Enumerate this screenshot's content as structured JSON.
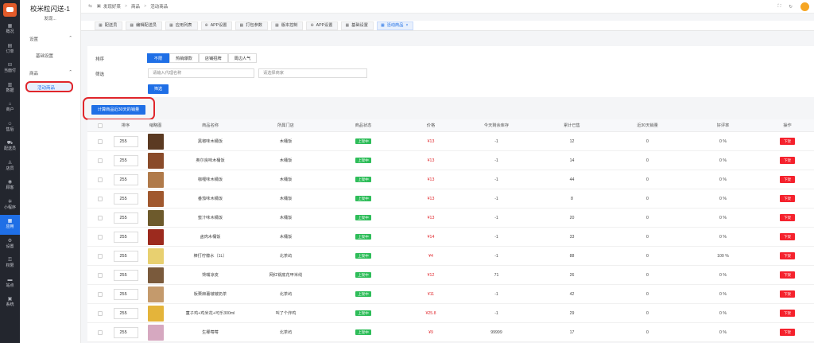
{
  "nav": {
    "items": [
      {
        "icon": "▦",
        "label": "概况"
      },
      {
        "icon": "▤",
        "label": "订单"
      },
      {
        "icon": "⊟",
        "label": "当面付"
      },
      {
        "icon": "▥",
        "label": "数据"
      },
      {
        "icon": "⌂",
        "label": "商户"
      },
      {
        "icon": "☺",
        "label": "售后"
      },
      {
        "icon": "⛟",
        "label": "配送员"
      },
      {
        "icon": "♙",
        "label": "店员"
      },
      {
        "icon": "◉",
        "label": "顾客"
      },
      {
        "icon": "✲",
        "label": "小程序"
      },
      {
        "icon": "▦",
        "label": "应用"
      },
      {
        "icon": "⚙",
        "label": "设置"
      },
      {
        "icon": "⚿",
        "label": "权限"
      },
      {
        "icon": "▬",
        "label": "站点"
      },
      {
        "icon": "▣",
        "label": "系统"
      }
    ],
    "active_index": 10
  },
  "sidebar": {
    "shop_name": "校米粒闪送-1",
    "shop_sub": "发现...",
    "group1": "设置",
    "group1_item": "基础设置",
    "group2": "商品",
    "active_item": "活动商品"
  },
  "topbar": {
    "crumb1": "发现好菜",
    "crumb2": "商品",
    "crumb3": "活动商品"
  },
  "tabs": [
    {
      "label": "配送员",
      "active": false
    },
    {
      "label": "编辑配送员",
      "active": false
    },
    {
      "label": "应用列表",
      "active": false
    },
    {
      "label": "APP设置",
      "active": false
    },
    {
      "label": "打包参数",
      "active": false
    },
    {
      "label": "版本控制",
      "active": false
    },
    {
      "label": "APP设置",
      "active": false
    },
    {
      "label": "基础设置",
      "active": false
    },
    {
      "label": "活动商品",
      "active": true
    }
  ],
  "filter": {
    "sort_label": "排序",
    "sort_options": [
      "不限",
      "热销爆款",
      "店铺招牌",
      "周边人气"
    ],
    "filter_label": "筛选",
    "name_placeholder": "请输入代理名称",
    "shop_placeholder": "请选择商家",
    "filter_button": "筛选",
    "calc_button": "计算商品近30天的销量"
  },
  "table": {
    "headers": [
      "",
      "排序",
      "缩略图",
      "商品名称",
      "所属门店",
      "商品状态",
      "价格",
      "今天剩余库存",
      "累计已售",
      "近30天销量",
      "好评率",
      "操作"
    ],
    "status_text": "上架中",
    "delete_text": "下架",
    "rows": [
      {
        "sort": "255",
        "thumb_color": "#5b3a22",
        "name": "黑椒味木桶饭",
        "store": "木桶饭",
        "price": "¥13",
        "stock": "-1",
        "sold": "12",
        "sales30": "0",
        "rating": "0 %"
      },
      {
        "sort": "255",
        "thumb_color": "#8a4b2a",
        "name": "奥尔良味木桶饭",
        "store": "木桶饭",
        "price": "¥13",
        "stock": "-1",
        "sold": "14",
        "sales30": "0",
        "rating": "0 %"
      },
      {
        "sort": "255",
        "thumb_color": "#b07a4a",
        "name": "咖喱味木桶饭",
        "store": "木桶饭",
        "price": "¥13",
        "stock": "-1",
        "sold": "44",
        "sales30": "0",
        "rating": "0 %"
      },
      {
        "sort": "255",
        "thumb_color": "#a0582e",
        "name": "番茄味木桶饭",
        "store": "木桶饭",
        "price": "¥13",
        "stock": "-1",
        "sold": "8",
        "sales30": "0",
        "rating": "0 %"
      },
      {
        "sort": "255",
        "thumb_color": "#6d5a2c",
        "name": "蜜汁味木桶饭",
        "store": "木桶饭",
        "price": "¥13",
        "stock": "-1",
        "sold": "20",
        "sales30": "0",
        "rating": "0 %"
      },
      {
        "sort": "255",
        "thumb_color": "#9c2a1e",
        "name": "卤肉木桶饭",
        "store": "木桶饭",
        "price": "¥14",
        "stock": "-1",
        "sold": "33",
        "sales30": "0",
        "rating": "0 %"
      },
      {
        "sort": "255",
        "thumb_color": "#e8d070",
        "name": "棒打柠檬水（1L）",
        "store": "北茶屿",
        "price": "¥4",
        "stock": "-1",
        "sold": "88",
        "sales30": "0",
        "rating": "100 %"
      },
      {
        "sort": "255",
        "thumb_color": "#7a5a3c",
        "name": "馋嘴凉皮",
        "store": "网红锅底花甲米线",
        "price": "¥12",
        "stock": "71",
        "sold": "26",
        "sales30": "0",
        "rating": "0 %"
      },
      {
        "sort": "255",
        "thumb_color": "#c49a6c",
        "name": "板栗麻薯啵啵奶茶",
        "store": "北茶屿",
        "price": "¥11",
        "stock": "-1",
        "sold": "42",
        "sales30": "0",
        "rating": "0 %"
      },
      {
        "sort": "255",
        "thumb_color": "#e4b43a",
        "name": "童子鸡+鸡米花+可乐300ml",
        "store": "叫了个炸鸡",
        "price": "¥25.8",
        "stock": "-1",
        "sold": "29",
        "sales30": "0",
        "rating": "0 %"
      },
      {
        "sort": "255",
        "thumb_color": "#d6a8c0",
        "name": "生椰莓莓",
        "store": "北茶屿",
        "price": "¥9",
        "stock": "99999",
        "sold": "17",
        "sales30": "0",
        "rating": "0 %"
      }
    ]
  }
}
